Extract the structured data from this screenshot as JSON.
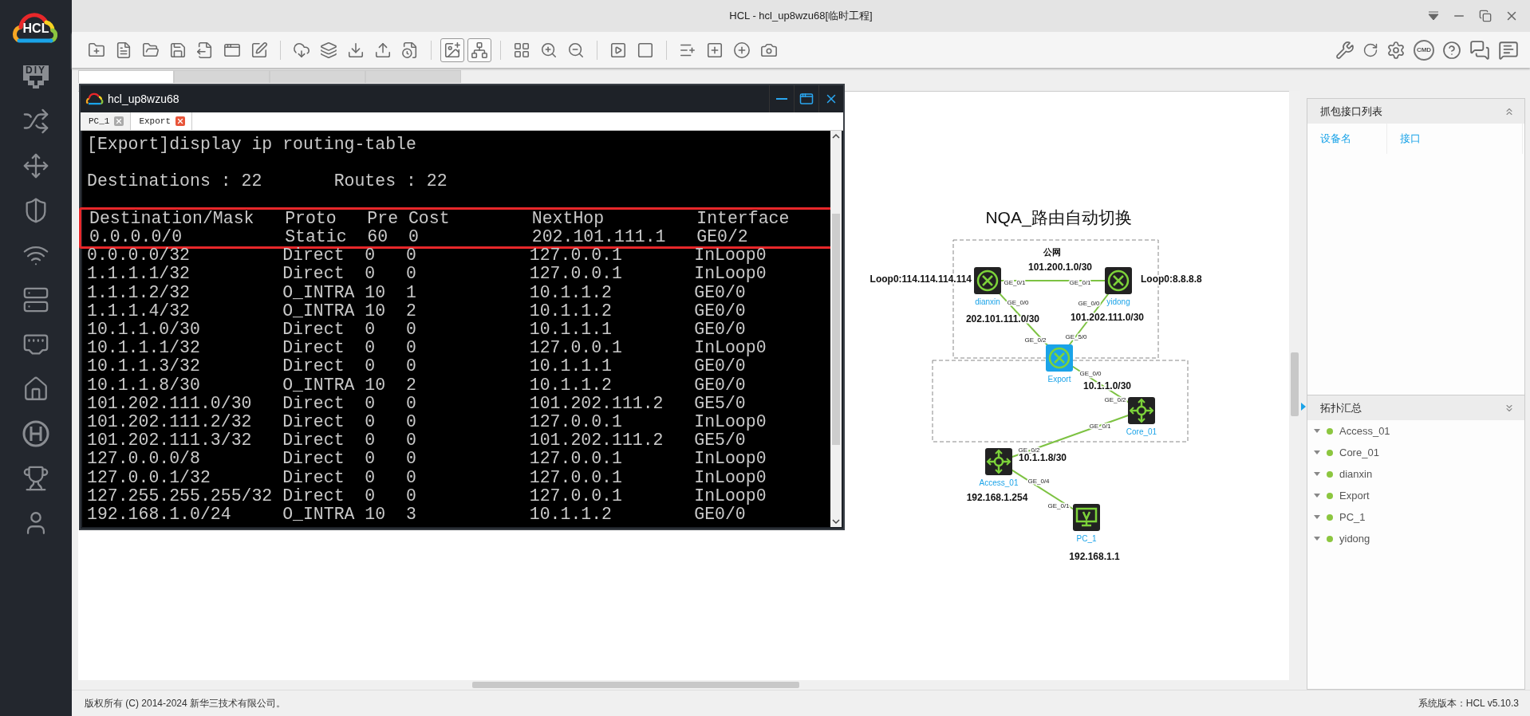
{
  "window": {
    "title": "HCL - hcl_up8wzu68[临时工程]"
  },
  "sidebar": {
    "logo": "HCL",
    "diy": "DIY"
  },
  "toolbar": {
    "buttons": [
      {
        "on": false
      },
      {
        "on": false
      },
      {
        "on": false
      },
      {
        "on": false
      },
      {
        "on": false
      },
      {
        "on": false
      },
      {
        "on": false
      },
      {
        "on": false
      },
      {
        "on": false
      },
      {
        "on": false
      },
      {
        "on": false
      },
      {
        "on": false
      },
      {
        "on": true
      },
      {
        "on": true
      },
      {
        "on": false
      },
      {
        "on": false
      },
      {
        "on": false
      },
      {
        "on": false
      },
      {
        "on": false
      },
      {
        "on": false
      },
      {
        "on": false
      },
      {
        "on": false
      },
      {
        "on": false
      }
    ],
    "cmd_label": "CMD"
  },
  "tabs": [
    {
      "selected": true
    },
    {
      "selected": false
    },
    {
      "selected": false
    },
    {
      "selected": false
    }
  ],
  "terminal": {
    "title": "hcl_up8wzu68",
    "tabs": [
      {
        "label": "PC_1",
        "selected": false
      },
      {
        "label": "Export",
        "selected": true
      }
    ],
    "command": "[Export]display ip routing-table",
    "summary": "Destinations : 22       Routes : 22",
    "rows": [
      {
        "text": "Destination/Mask   Proto   Pre Cost        NextHop         Interface",
        "highlighted": true
      },
      {
        "text": "0.0.0.0/0          Static  60  0           202.101.111.1   GE0/2",
        "highlighted": true
      },
      {
        "text": "0.0.0.0/32         Direct  0   0           127.0.0.1       InLoop0",
        "highlighted": false
      },
      {
        "text": "1.1.1.1/32         Direct  0   0           127.0.0.1       InLoop0",
        "highlighted": false
      },
      {
        "text": "1.1.1.2/32         O_INTRA 10  1           10.1.1.2        GE0/0",
        "highlighted": false
      },
      {
        "text": "1.1.1.4/32         O_INTRA 10  2           10.1.1.2        GE0/0",
        "highlighted": false
      },
      {
        "text": "10.1.1.0/30        Direct  0   0           10.1.1.1        GE0/0",
        "highlighted": false
      },
      {
        "text": "10.1.1.1/32        Direct  0   0           127.0.0.1       InLoop0",
        "highlighted": false
      },
      {
        "text": "10.1.1.3/32        Direct  0   0           10.1.1.1        GE0/0",
        "highlighted": false
      },
      {
        "text": "10.1.1.8/30        O_INTRA 10  2           10.1.1.2        GE0/0",
        "highlighted": false
      },
      {
        "text": "101.202.111.0/30   Direct  0   0           101.202.111.2   GE5/0",
        "highlighted": false
      },
      {
        "text": "101.202.111.2/32   Direct  0   0           127.0.0.1       InLoop0",
        "highlighted": false
      },
      {
        "text": "101.202.111.3/32   Direct  0   0           101.202.111.2   GE5/0",
        "highlighted": false
      },
      {
        "text": "127.0.0.0/8        Direct  0   0           127.0.0.1       InLoop0",
        "highlighted": false
      },
      {
        "text": "127.0.0.1/32       Direct  0   0           127.0.0.1       InLoop0",
        "highlighted": false
      },
      {
        "text": "127.255.255.255/32 Direct  0   0           127.0.0.1       InLoop0",
        "highlighted": false
      },
      {
        "text": "192.168.1.0/24     O_INTRA 10  3           10.1.1.2        GE0/0",
        "highlighted": false
      }
    ]
  },
  "topology": {
    "title": "NQA_路由自动切换",
    "area_label": "公网",
    "nodes": [
      {
        "kind": "router",
        "name": "dianxin",
        "selected": false
      },
      {
        "kind": "router",
        "name": "yidong",
        "selected": false
      },
      {
        "kind": "router",
        "name": "Export",
        "selected": true
      },
      {
        "kind": "switch",
        "name": "Core_01",
        "selected": false
      },
      {
        "kind": "switch",
        "name": "Access_01",
        "selected": false
      },
      {
        "kind": "pc",
        "name": "PC_1",
        "selected": false
      }
    ],
    "links": [
      {
        "ports": [
          "GE_0/1",
          "GE_0/1"
        ]
      },
      {
        "ports": [
          "GE_0/0",
          "GE_0/2"
        ]
      },
      {
        "ports": [
          "GE_0/0",
          "GE_5/0"
        ]
      },
      {
        "ports": [
          "GE_0/0",
          "GE_0/2"
        ]
      },
      {
        "ports": [
          "GE_0/1",
          "GE_0/2"
        ]
      },
      {
        "ports": [
          "GE_0/4",
          "GE_0/1"
        ]
      }
    ],
    "annotations": [
      "101.200.1.0/30",
      "Loop0:114.114.114.114",
      "Loop0:8.8.8.8",
      "202.101.111.0/30",
      "101.202.111.0/30",
      "10.1.1.0/30",
      "10.1.1.8/30",
      "192.168.1.254",
      "192.168.1.1"
    ]
  },
  "capture_panel": {
    "title": "抓包接口列表",
    "columns": [
      "设备名",
      "接口"
    ]
  },
  "summary_panel": {
    "title": "拓扑汇总",
    "items": [
      "Access_01",
      "Core_01",
      "dianxin",
      "Export",
      "PC_1",
      "yidong"
    ]
  },
  "status_bar": {
    "copyright": "版权所有 (C) 2014-2024 新华三技术有限公司。",
    "version": "系统版本：HCL v5.10.3"
  }
}
